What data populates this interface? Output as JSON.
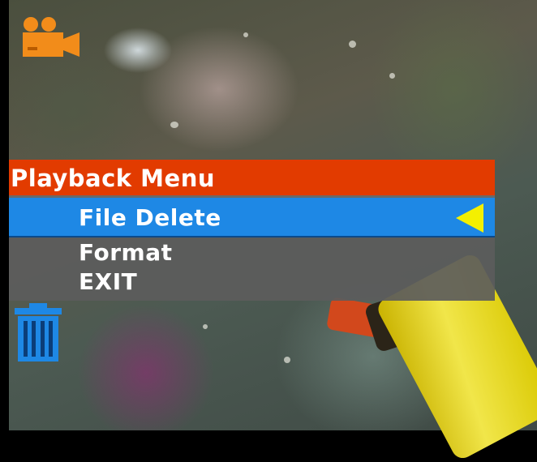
{
  "menu": {
    "title": "Playback Menu",
    "items": [
      {
        "label": "File Delete",
        "selected": true
      },
      {
        "label": "Format",
        "selected": false
      },
      {
        "label": "EXIT",
        "selected": false
      }
    ]
  },
  "icons": {
    "mode": "camcorder-icon",
    "action": "trash-icon",
    "selector": "selector-arrow-icon"
  },
  "colors": {
    "title_bar": "#e23b00",
    "selected_item": "#1e88e5",
    "item_bg": "#5c5c5c",
    "selector_arrow": "#f4f000",
    "camcorder_icon": "#f28c1a",
    "trash_icon": "#1e88e5"
  }
}
